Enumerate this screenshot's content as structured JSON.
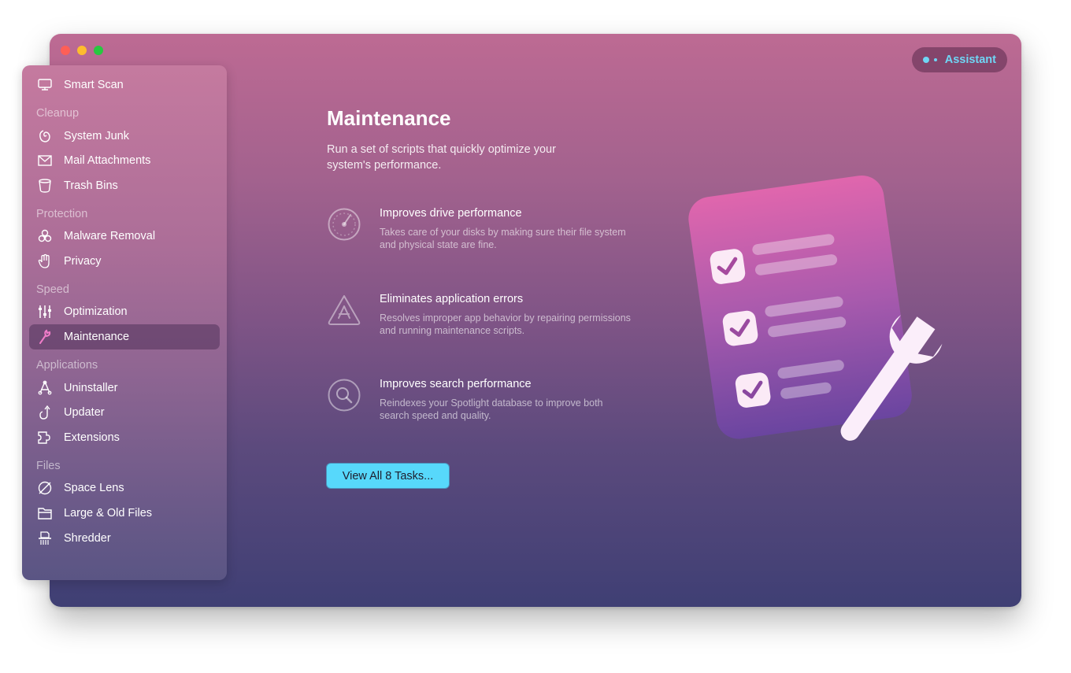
{
  "window": {
    "traffic_lights": [
      "close",
      "minimize",
      "zoom"
    ],
    "assistant": {
      "label": "Assistant",
      "icon": "assistant-dots-icon",
      "color": "#6fd6f5"
    }
  },
  "sidebar": {
    "top_item": {
      "label": "Smart Scan",
      "icon": "monitor-icon"
    },
    "sections": [
      {
        "heading": "Cleanup",
        "items": [
          {
            "label": "System Junk",
            "icon": "system-junk-icon"
          },
          {
            "label": "Mail Attachments",
            "icon": "mail-icon"
          },
          {
            "label": "Trash Bins",
            "icon": "trash-bin-icon"
          }
        ]
      },
      {
        "heading": "Protection",
        "items": [
          {
            "label": "Malware Removal",
            "icon": "biohazard-icon"
          },
          {
            "label": "Privacy",
            "icon": "hand-icon"
          }
        ]
      },
      {
        "heading": "Speed",
        "items": [
          {
            "label": "Optimization",
            "icon": "sliders-icon"
          },
          {
            "label": "Maintenance",
            "icon": "wrench-icon",
            "active": true
          }
        ]
      },
      {
        "heading": "Applications",
        "items": [
          {
            "label": "Uninstaller",
            "icon": "uninstaller-icon"
          },
          {
            "label": "Updater",
            "icon": "update-arrow-icon"
          },
          {
            "label": "Extensions",
            "icon": "puzzle-icon"
          }
        ]
      },
      {
        "heading": "Files",
        "items": [
          {
            "label": "Space Lens",
            "icon": "planet-icon"
          },
          {
            "label": "Large & Old Files",
            "icon": "folder-icon"
          },
          {
            "label": "Shredder",
            "icon": "shredder-icon"
          }
        ]
      }
    ]
  },
  "main": {
    "title": "Maintenance",
    "subtitle": "Run a set of scripts that quickly optimize your system's performance.",
    "features": [
      {
        "title": "Improves drive performance",
        "description": "Takes care of your disks by making sure their file system and physical state are fine.",
        "icon": "gauge-icon"
      },
      {
        "title": "Eliminates application errors",
        "description": "Resolves improper app behavior by repairing permissions and running maintenance scripts.",
        "icon": "app-store-triangle-icon"
      },
      {
        "title": "Improves search performance",
        "description": "Reindexes your Spotlight database to improve both search speed and quality.",
        "icon": "search-icon"
      }
    ],
    "cta_label": "View All 8 Tasks...",
    "cta_color": "#57d8fb",
    "illustration": "checklist-with-wrench-illustration"
  }
}
